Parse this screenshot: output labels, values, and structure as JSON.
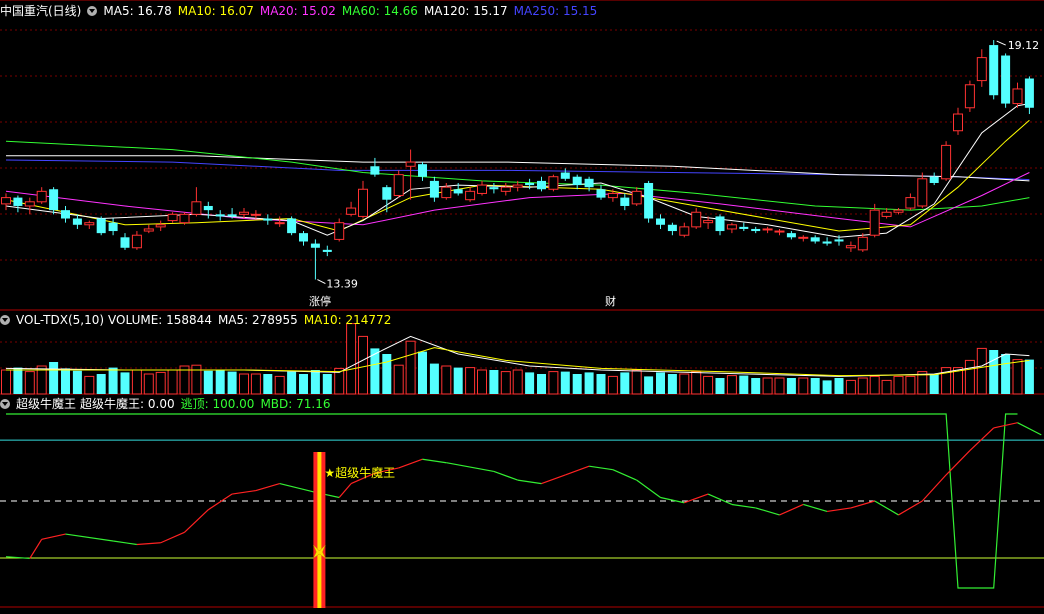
{
  "header": {
    "title": "中国重汽(日线)",
    "ma": [
      {
        "label": "MA5: 16.78",
        "color": "#ffffff"
      },
      {
        "label": "MA10: 16.07",
        "color": "#ffff00"
      },
      {
        "label": "MA20: 15.02",
        "color": "#ff33ff"
      },
      {
        "label": "MA60: 14.66",
        "color": "#33ff33"
      },
      {
        "label": "MA120: 15.17",
        "color": "#ffffff"
      },
      {
        "label": "MA250: 15.15",
        "color": "#4444ff"
      }
    ]
  },
  "volume_header": {
    "title": "VOL-TDX(5,10)",
    "volume": "VOLUME: 158844",
    "ma5": "MA5: 278955",
    "ma10": "MA10: 214772"
  },
  "indicator_header": {
    "title": "超级牛魔王",
    "value": "超级牛魔王: 0.00",
    "escape": "逃顶: 100.00",
    "mbd": "MBD: 71.16"
  },
  "annotations": {
    "high": "19.12",
    "low": "13.39",
    "limit_up": "涨停",
    "cai": "财",
    "signal": "★超级牛魔王"
  },
  "colors": {
    "up": "#ff3232",
    "down": "#54ffff",
    "grid": "#7a0000",
    "ma5": "#ffffff",
    "ma10": "#ffff00",
    "ma20": "#ff33ff",
    "ma60": "#33ff33",
    "ma120": "#ffffff",
    "ma250": "#4444ff"
  },
  "chart_data": {
    "type": "candlestick",
    "price_range": [
      12.9,
      19.6
    ],
    "candles": [
      [
        15.2,
        15.35,
        15.45,
        15.05
      ],
      [
        15.35,
        15.15,
        15.4,
        15.0
      ],
      [
        15.15,
        15.25,
        15.35,
        14.95
      ],
      [
        15.25,
        15.5,
        15.6,
        15.2
      ],
      [
        15.55,
        15.05,
        15.6,
        14.95
      ],
      [
        15.05,
        14.85,
        15.15,
        14.75
      ],
      [
        14.85,
        14.7,
        14.95,
        14.6
      ],
      [
        14.7,
        14.75,
        14.8,
        14.6
      ],
      [
        14.85,
        14.5,
        14.9,
        14.45
      ],
      [
        14.75,
        14.55,
        14.85,
        14.45
      ],
      [
        14.4,
        14.15,
        14.5,
        14.1
      ],
      [
        14.15,
        14.45,
        14.55,
        14.1
      ],
      [
        14.55,
        14.6,
        14.7,
        14.5
      ],
      [
        14.65,
        14.7,
        14.8,
        14.55
      ],
      [
        14.8,
        14.95,
        15.0,
        14.75
      ],
      [
        14.75,
        14.95,
        15.0,
        14.7
      ],
      [
        14.95,
        15.25,
        15.6,
        14.9
      ],
      [
        15.15,
        15.05,
        15.25,
        14.85
      ],
      [
        14.95,
        14.9,
        15.05,
        14.8
      ],
      [
        14.95,
        14.9,
        15.1,
        14.85
      ],
      [
        14.95,
        15.0,
        15.1,
        14.85
      ],
      [
        14.95,
        14.95,
        15.05,
        14.85
      ],
      [
        14.85,
        14.8,
        14.95,
        14.7
      ],
      [
        14.75,
        14.75,
        14.9,
        14.65
      ],
      [
        14.85,
        14.5,
        14.9,
        14.45
      ],
      [
        14.5,
        14.3,
        14.55,
        14.2
      ],
      [
        14.25,
        14.15,
        14.35,
        13.39
      ],
      [
        14.1,
        14.05,
        14.2,
        13.95
      ],
      [
        14.35,
        14.75,
        14.85,
        14.3
      ],
      [
        14.95,
        15.1,
        15.25,
        14.9
      ],
      [
        14.9,
        15.55,
        15.75,
        14.85
      ],
      [
        16.1,
        15.9,
        16.3,
        15.85
      ],
      [
        15.6,
        15.3,
        15.65,
        15.0
      ],
      [
        15.4,
        15.9,
        16.0,
        15.35
      ],
      [
        16.1,
        16.2,
        16.5,
        15.3
      ],
      [
        16.15,
        15.85,
        16.2,
        15.75
      ],
      [
        15.75,
        15.35,
        15.85,
        15.25
      ],
      [
        15.35,
        15.6,
        15.7,
        15.3
      ],
      [
        15.55,
        15.45,
        15.7,
        15.4
      ],
      [
        15.3,
        15.5,
        15.6,
        15.25
      ],
      [
        15.45,
        15.65,
        15.75,
        15.4
      ],
      [
        15.6,
        15.55,
        15.7,
        15.45
      ],
      [
        15.5,
        15.6,
        15.7,
        15.4
      ],
      [
        15.6,
        15.65,
        15.75,
        15.5
      ],
      [
        15.7,
        15.65,
        15.8,
        15.55
      ],
      [
        15.75,
        15.55,
        15.85,
        15.5
      ],
      [
        15.55,
        15.85,
        15.9,
        15.5
      ],
      [
        15.95,
        15.8,
        16.05,
        15.75
      ],
      [
        15.85,
        15.65,
        15.9,
        15.55
      ],
      [
        15.8,
        15.6,
        15.85,
        15.5
      ],
      [
        15.55,
        15.35,
        15.65,
        15.3
      ],
      [
        15.35,
        15.45,
        15.55,
        15.25
      ],
      [
        15.35,
        15.15,
        15.45,
        15.05
      ],
      [
        15.2,
        15.5,
        15.6,
        15.15
      ],
      [
        15.7,
        14.85,
        15.75,
        14.75
      ],
      [
        14.85,
        14.7,
        14.95,
        14.6
      ],
      [
        14.7,
        14.55,
        14.75,
        14.45
      ],
      [
        14.45,
        14.65,
        14.75,
        14.4
      ],
      [
        14.65,
        15.0,
        15.1,
        14.6
      ],
      [
        14.75,
        14.8,
        14.9,
        14.6
      ],
      [
        14.9,
        14.55,
        14.95,
        14.45
      ],
      [
        14.6,
        14.7,
        14.75,
        14.5
      ],
      [
        14.65,
        14.6,
        14.75,
        14.55
      ],
      [
        14.6,
        14.55,
        14.65,
        14.5
      ],
      [
        14.6,
        14.6,
        14.65,
        14.5
      ],
      [
        14.55,
        14.55,
        14.6,
        14.45
      ],
      [
        14.5,
        14.4,
        14.55,
        14.35
      ],
      [
        14.4,
        14.4,
        14.45,
        14.3
      ],
      [
        14.4,
        14.3,
        14.45,
        14.25
      ],
      [
        14.3,
        14.25,
        14.4,
        14.2
      ],
      [
        14.35,
        14.3,
        14.45,
        14.2
      ],
      [
        14.15,
        14.2,
        14.3,
        14.05
      ],
      [
        14.1,
        14.4,
        14.5,
        14.05
      ],
      [
        14.45,
        15.05,
        15.2,
        14.4
      ],
      [
        14.9,
        15.0,
        15.1,
        14.85
      ],
      [
        15.0,
        15.05,
        15.1,
        14.95
      ],
      [
        15.1,
        15.35,
        15.45,
        15.05
      ],
      [
        15.15,
        15.8,
        15.95,
        15.1
      ],
      [
        15.85,
        15.7,
        15.95,
        15.65
      ],
      [
        15.8,
        16.6,
        16.7,
        15.75
      ],
      [
        16.95,
        17.35,
        17.5,
        16.85
      ],
      [
        17.5,
        18.05,
        18.15,
        17.4
      ],
      [
        18.15,
        18.7,
        18.9,
        18.0
      ],
      [
        19.0,
        17.8,
        19.12,
        17.7
      ],
      [
        18.75,
        17.6,
        18.8,
        17.5
      ],
      [
        17.6,
        17.95,
        18.1,
        17.5
      ],
      [
        18.2,
        17.5,
        18.25,
        17.35
      ]
    ],
    "ma": {
      "ma5": [
        [
          0,
          15.15
        ],
        [
          8,
          14.85
        ],
        [
          16,
          14.95
        ],
        [
          24,
          14.8
        ],
        [
          27,
          14.45
        ],
        [
          30,
          14.8
        ],
        [
          34,
          15.55
        ],
        [
          38,
          15.65
        ],
        [
          44,
          15.6
        ],
        [
          50,
          15.7
        ],
        [
          54,
          15.35
        ],
        [
          58,
          14.9
        ],
        [
          64,
          14.7
        ],
        [
          70,
          14.4
        ],
        [
          74,
          14.5
        ],
        [
          78,
          15.2
        ],
        [
          82,
          16.9
        ],
        [
          85,
          17.55
        ],
        [
          86,
          17.6
        ]
      ],
      "ma10": [
        [
          0,
          15.3
        ],
        [
          10,
          14.7
        ],
        [
          16,
          14.75
        ],
        [
          24,
          14.85
        ],
        [
          28,
          14.55
        ],
        [
          34,
          15.35
        ],
        [
          40,
          15.65
        ],
        [
          50,
          15.55
        ],
        [
          56,
          15.25
        ],
        [
          64,
          14.85
        ],
        [
          70,
          14.55
        ],
        [
          76,
          14.7
        ],
        [
          80,
          15.6
        ],
        [
          84,
          16.7
        ],
        [
          86,
          17.2
        ]
      ],
      "ma20": [
        [
          0,
          15.5
        ],
        [
          10,
          15.15
        ],
        [
          20,
          14.85
        ],
        [
          30,
          14.7
        ],
        [
          36,
          15.05
        ],
        [
          44,
          15.35
        ],
        [
          52,
          15.45
        ],
        [
          60,
          15.2
        ],
        [
          70,
          14.85
        ],
        [
          76,
          14.65
        ],
        [
          82,
          15.4
        ],
        [
          86,
          15.95
        ]
      ],
      "ma60": [
        [
          0,
          16.7
        ],
        [
          14,
          16.5
        ],
        [
          24,
          16.2
        ],
        [
          30,
          15.95
        ],
        [
          40,
          15.75
        ],
        [
          50,
          15.65
        ],
        [
          58,
          15.45
        ],
        [
          68,
          15.15
        ],
        [
          76,
          15.05
        ],
        [
          82,
          15.15
        ],
        [
          86,
          15.35
        ]
      ],
      "ma120": [
        [
          0,
          16.35
        ],
        [
          16,
          16.35
        ],
        [
          30,
          16.2
        ],
        [
          42,
          16.2
        ],
        [
          56,
          16.1
        ],
        [
          70,
          15.9
        ],
        [
          80,
          15.85
        ],
        [
          86,
          15.75
        ]
      ],
      "ma250": [
        [
          0,
          16.25
        ],
        [
          14,
          16.2
        ],
        [
          28,
          16.0
        ],
        [
          42,
          16.0
        ],
        [
          56,
          15.95
        ],
        [
          70,
          15.9
        ],
        [
          80,
          15.85
        ],
        [
          86,
          15.78
        ]
      ]
    },
    "volume": [
      0.3,
      0.33,
      0.28,
      0.35,
      0.4,
      0.32,
      0.29,
      0.22,
      0.25,
      0.33,
      0.27,
      0.3,
      0.25,
      0.27,
      0.3,
      0.35,
      0.36,
      0.29,
      0.3,
      0.28,
      0.25,
      0.25,
      0.25,
      0.22,
      0.28,
      0.25,
      0.3,
      0.25,
      0.32,
      0.88,
      0.72,
      0.57,
      0.5,
      0.36,
      0.66,
      0.53,
      0.38,
      0.35,
      0.33,
      0.33,
      0.3,
      0.3,
      0.28,
      0.3,
      0.27,
      0.25,
      0.28,
      0.28,
      0.25,
      0.27,
      0.25,
      0.22,
      0.27,
      0.3,
      0.22,
      0.27,
      0.25,
      0.25,
      0.28,
      0.22,
      0.2,
      0.23,
      0.23,
      0.2,
      0.2,
      0.2,
      0.2,
      0.2,
      0.2,
      0.17,
      0.2,
      0.17,
      0.2,
      0.22,
      0.17,
      0.22,
      0.22,
      0.28,
      0.25,
      0.33,
      0.33,
      0.42,
      0.57,
      0.55,
      0.5,
      0.43,
      0.43
    ],
    "vol_ma5": [
      [
        0,
        0.32
      ],
      [
        10,
        0.3
      ],
      [
        20,
        0.3
      ],
      [
        28,
        0.27
      ],
      [
        31,
        0.5
      ],
      [
        34,
        0.72
      ],
      [
        38,
        0.5
      ],
      [
        44,
        0.35
      ],
      [
        50,
        0.3
      ],
      [
        60,
        0.26
      ],
      [
        70,
        0.22
      ],
      [
        78,
        0.25
      ],
      [
        82,
        0.35
      ],
      [
        84,
        0.5
      ],
      [
        86,
        0.48
      ]
    ],
    "vol_ma10": [
      [
        0,
        0.3
      ],
      [
        20,
        0.3
      ],
      [
        28,
        0.28
      ],
      [
        32,
        0.4
      ],
      [
        36,
        0.58
      ],
      [
        42,
        0.42
      ],
      [
        50,
        0.32
      ],
      [
        60,
        0.28
      ],
      [
        70,
        0.23
      ],
      [
        78,
        0.24
      ],
      [
        84,
        0.38
      ],
      [
        86,
        0.42
      ]
    ],
    "indicator": [
      [
        0,
        0.18
      ],
      [
        2,
        0.17
      ],
      [
        3,
        0.28
      ],
      [
        5,
        0.31
      ],
      [
        9,
        0.27
      ],
      [
        11,
        0.25
      ],
      [
        13,
        0.26
      ],
      [
        15,
        0.32
      ],
      [
        17,
        0.45
      ],
      [
        19,
        0.54
      ],
      [
        21,
        0.56
      ],
      [
        23,
        0.6
      ],
      [
        26,
        0.55
      ],
      [
        28,
        0.52
      ],
      [
        29,
        0.6
      ],
      [
        31,
        0.66
      ],
      [
        33,
        0.69
      ],
      [
        35,
        0.74
      ],
      [
        37,
        0.72
      ],
      [
        41,
        0.67
      ],
      [
        43,
        0.62
      ],
      [
        45,
        0.6
      ],
      [
        47,
        0.65
      ],
      [
        49,
        0.7
      ],
      [
        51,
        0.68
      ],
      [
        53,
        0.62
      ],
      [
        55,
        0.52
      ],
      [
        57,
        0.49
      ],
      [
        59,
        0.54
      ],
      [
        61,
        0.48
      ],
      [
        63,
        0.46
      ],
      [
        65,
        0.42
      ],
      [
        67,
        0.48
      ],
      [
        69,
        0.44
      ],
      [
        71,
        0.46
      ],
      [
        73,
        0.5
      ],
      [
        75,
        0.42
      ],
      [
        77,
        0.5
      ],
      [
        79,
        0.65
      ],
      [
        81,
        0.79
      ],
      [
        83,
        0.92
      ],
      [
        85,
        0.95
      ],
      [
        87,
        0.88
      ]
    ],
    "escape": [
      [
        0,
        1.0
      ],
      [
        79,
        1.0
      ],
      [
        80,
        0.0
      ],
      [
        83,
        0.0
      ],
      [
        84,
        1.0
      ],
      [
        85,
        1.0
      ]
    ],
    "indicator_levels": [
      0.0,
      0.5,
      0.85
    ],
    "signal_index": 26
  }
}
